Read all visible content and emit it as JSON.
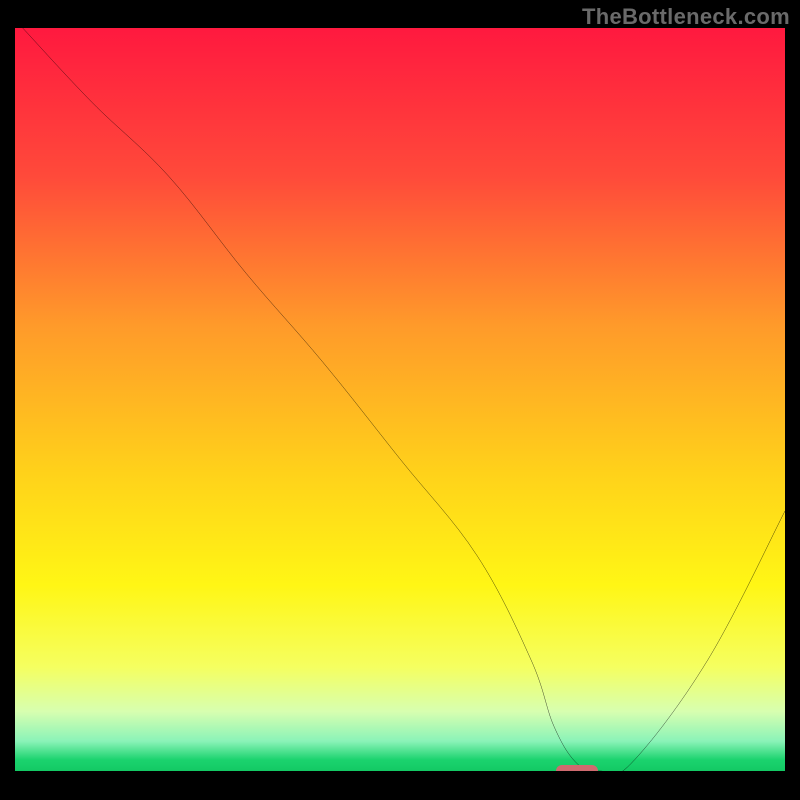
{
  "watermark": "TheBottleneck.com",
  "chart_data": {
    "type": "line",
    "title": "",
    "xlabel": "",
    "ylabel": "",
    "xlim": [
      0,
      100
    ],
    "ylim": [
      0,
      100
    ],
    "x": [
      1,
      10,
      20,
      30,
      40,
      50,
      60,
      67,
      70,
      73,
      76,
      80,
      90,
      100
    ],
    "values": [
      100,
      90,
      80,
      67,
      55,
      42,
      29,
      15,
      6,
      1,
      0,
      1,
      15,
      35
    ],
    "gradient_stops": [
      {
        "pos": 0,
        "color": "#ff193f"
      },
      {
        "pos": 20,
        "color": "#ff4a3a"
      },
      {
        "pos": 40,
        "color": "#ff9a2a"
      },
      {
        "pos": 60,
        "color": "#ffd21a"
      },
      {
        "pos": 75,
        "color": "#fff615"
      },
      {
        "pos": 86,
        "color": "#f5ff60"
      },
      {
        "pos": 92,
        "color": "#d7ffb0"
      },
      {
        "pos": 96,
        "color": "#8af3b8"
      },
      {
        "pos": 98.5,
        "color": "#1bd36e"
      },
      {
        "pos": 100,
        "color": "#13c964"
      }
    ],
    "marker": {
      "x": 73,
      "y": 0,
      "width_pct": 5.5,
      "height_pct": 1.6
    }
  }
}
